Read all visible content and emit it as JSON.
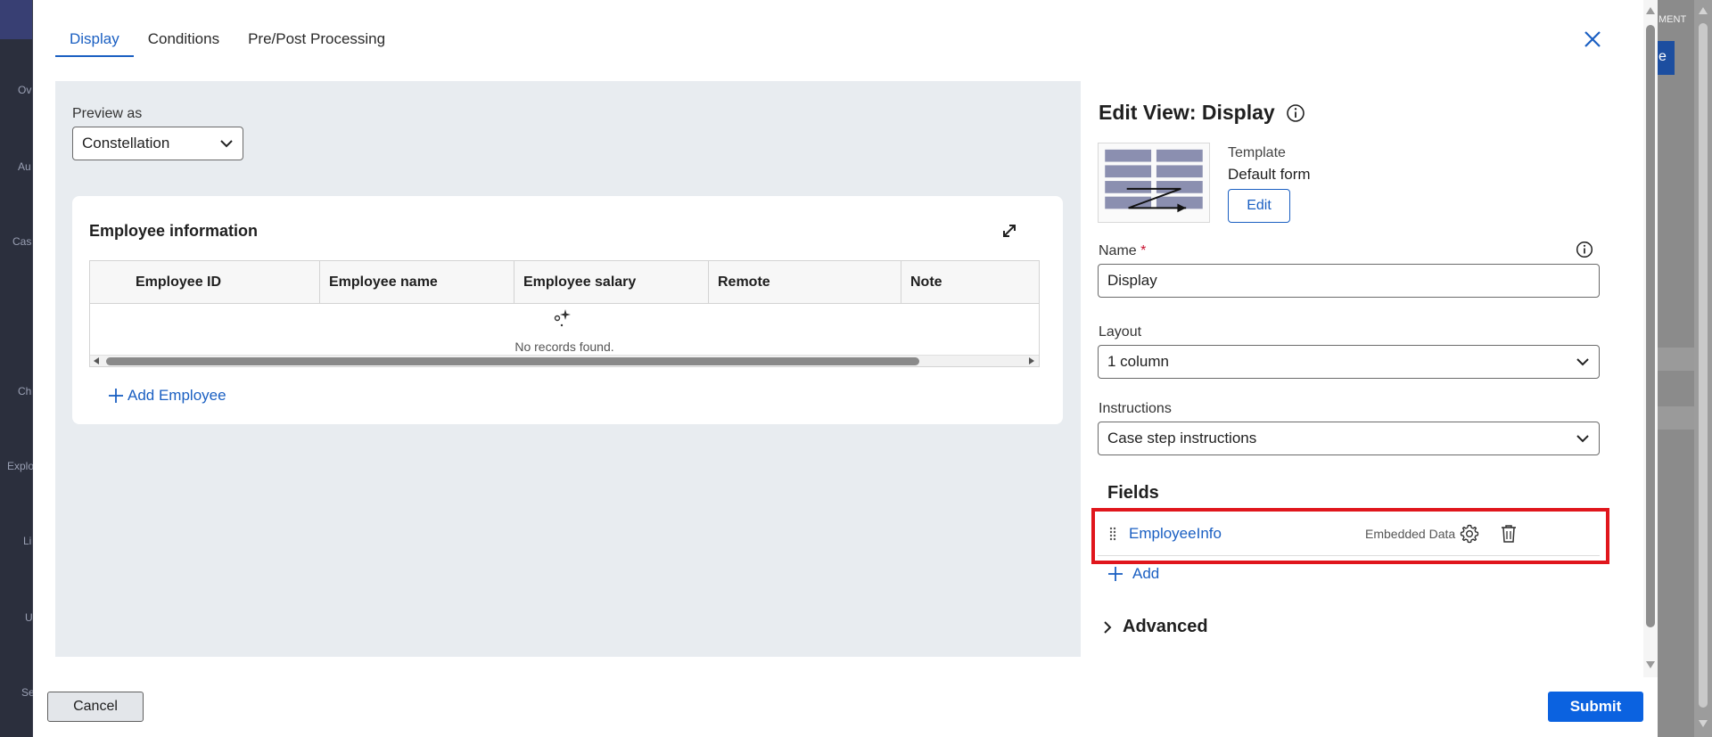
{
  "background_app": {
    "left_fragments": [
      "Ov",
      "Au",
      "Cas",
      "Ch",
      "Explo",
      "Li",
      "U",
      "Se"
    ],
    "right_fragments": [
      "MENT",
      "e"
    ]
  },
  "tabs": [
    {
      "label": "Display",
      "active": true
    },
    {
      "label": "Conditions",
      "active": false
    },
    {
      "label": "Pre/Post Processing",
      "active": false
    }
  ],
  "preview": {
    "label": "Preview as",
    "selected": "Constellation",
    "card": {
      "title": "Employee information",
      "columns": [
        "Employee ID",
        "Employee name",
        "Employee salary",
        "Remote",
        "Note"
      ],
      "empty_text": "No records found.",
      "add_label": "Add Employee"
    }
  },
  "edit_view": {
    "title": "Edit View: Display",
    "template_label": "Template",
    "template_value": "Default form",
    "edit_button": "Edit",
    "name_label": "Name",
    "name_required": "*",
    "name_value": "Display",
    "layout_label": "Layout",
    "layout_value": "1 column",
    "instructions_label": "Instructions",
    "instructions_value": "Case step instructions",
    "fields_heading": "Fields",
    "fields": [
      {
        "name": "EmployeeInfo",
        "type": "Embedded Data"
      }
    ],
    "add_label": "Add",
    "advanced_label": "Advanced"
  },
  "footer": {
    "cancel": "Cancel",
    "submit": "Submit"
  },
  "colors": {
    "accent": "#1a5fc2",
    "submit": "#0b62e0",
    "highlight": "#e0161c",
    "preview_bg": "#e8ecf0"
  }
}
